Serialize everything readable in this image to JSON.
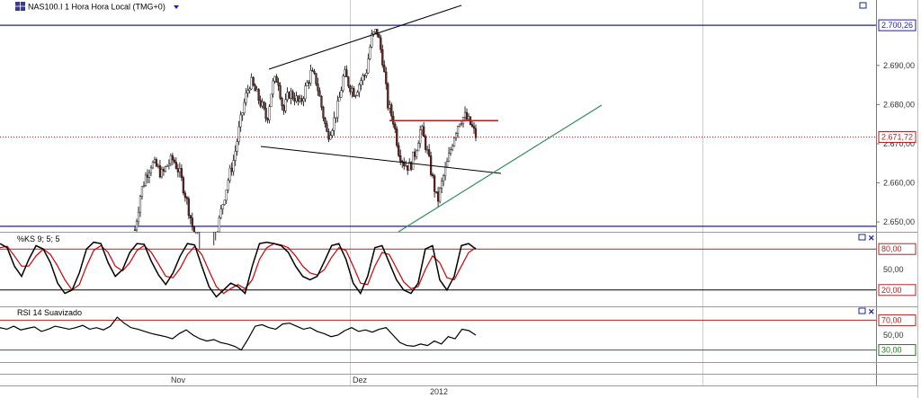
{
  "header": {
    "symbol_title": "NAS100.I 1 Hora Hora Local (TMG+0)",
    "symbol_icon": "symbol-grid-icon",
    "dropdown_icon": "caret-down-icon"
  },
  "colors": {
    "bull": "#ffffff",
    "bear": "#8b1a1a",
    "wick": "#000000",
    "hline_blue": "#1f1f9e",
    "last_price": "#b22222",
    "resistance": "#b22222",
    "uptrend": "#2e8b57",
    "stoch_k": "#000000",
    "stoch_d": "#cc0000",
    "rsi_line": "#000000",
    "rsi_upper": "#b22222",
    "rsi_lower": "#1a7a1a"
  },
  "price_panel": {
    "y_ticks": [
      "2.690,00",
      "2.680,00",
      "2.670,00",
      "2.660,00",
      "2.650,00"
    ],
    "y_tick_values": [
      2690,
      2680,
      2670,
      2660,
      2650
    ],
    "top_line_label": "2.700,26",
    "top_line_value": 2700.26,
    "last_price_label": "2.671,72",
    "last_price_value": 2671.72,
    "lower_line_value": 2648.9,
    "resistance_value": 2675.9,
    "y_range": [
      2647.5,
      2703.5
    ]
  },
  "stoch_panel": {
    "title": "%KS 9; 5; 5",
    "levels": [
      "80,00",
      "50,00",
      "20,00"
    ],
    "level_values": [
      80,
      50,
      20
    ],
    "upper_level": 80,
    "lower_level": 20,
    "y_range": [
      0,
      100
    ]
  },
  "rsi_panel": {
    "title": "RSI 14 Suavizado",
    "levels": [
      "70,00",
      "50,00",
      "30,00"
    ],
    "level_values": [
      70,
      50,
      30
    ],
    "upper_level": 70,
    "lower_level": 30,
    "y_range": [
      15,
      85
    ]
  },
  "x_axis": {
    "months": [
      "Nov",
      "Dez"
    ],
    "year": "2012"
  },
  "chart_data": {
    "type": "candlestick",
    "title": "NAS100.I 1 Hora Hora Local (TMG+0)",
    "xlabel": "",
    "ylabel": "",
    "x_labels": [
      "Nov",
      "Dez",
      "2012"
    ],
    "ylim": [
      2647.5,
      2703.5
    ],
    "series": [
      {
        "name": "NAS100.I",
        "close_path": [
          2648,
          2657,
          2662,
          2665,
          2664,
          2662,
          2665,
          2666,
          2663,
          2658,
          2652,
          2645,
          2640,
          2638,
          2641,
          2648,
          2655,
          2661,
          2666,
          2674,
          2681,
          2686,
          2683,
          2680,
          2676,
          2685,
          2687,
          2678,
          2683,
          2682,
          2680,
          2684,
          2688,
          2686,
          2679,
          2672,
          2675,
          2680,
          2688,
          2685,
          2683,
          2686,
          2688,
          2697,
          2699,
          2692,
          2680,
          2676,
          2668,
          2665,
          2664,
          2668,
          2674,
          2669,
          2662,
          2655,
          2661,
          2666,
          2672,
          2676,
          2677,
          2675,
          2672
        ]
      }
    ],
    "indicators": [
      {
        "name": "%KS 9; 5; 5",
        "k_path": [
          88,
          82,
          55,
          40,
          65,
          85,
          80,
          60,
          30,
          15,
          20,
          45,
          80,
          90,
          88,
          60,
          40,
          50,
          75,
          88,
          87,
          62,
          42,
          28,
          45,
          70,
          88,
          86,
          55,
          25,
          10,
          20,
          30,
          25,
          15,
          55,
          88,
          90,
          88,
          85,
          75,
          55,
          40,
          35,
          40,
          62,
          85,
          88,
          65,
          30,
          15,
          40,
          82,
          85,
          60,
          35,
          20,
          15,
          30,
          80,
          85,
          35,
          20,
          40,
          85,
          88,
          80
        ],
        "d_path": [
          82,
          84,
          70,
          55,
          55,
          70,
          80,
          72,
          55,
          35,
          20,
          28,
          55,
          78,
          85,
          75,
          55,
          48,
          60,
          78,
          85,
          75,
          58,
          40,
          38,
          52,
          72,
          84,
          72,
          48,
          25,
          15,
          22,
          28,
          22,
          35,
          65,
          82,
          88,
          86,
          82,
          70,
          55,
          45,
          42,
          50,
          68,
          82,
          78,
          55,
          30,
          28,
          55,
          75,
          72,
          52,
          32,
          22,
          25,
          50,
          70,
          60,
          38,
          35,
          55,
          75,
          82
        ]
      },
      {
        "name": "RSI 14 Suavizado",
        "rsi_path": [
          60,
          58,
          62,
          57,
          59,
          61,
          55,
          58,
          62,
          60,
          58,
          60,
          63,
          58,
          60,
          57,
          62,
          74,
          66,
          60,
          58,
          55,
          52,
          50,
          48,
          45,
          52,
          57,
          50,
          45,
          42,
          44,
          40,
          38,
          35,
          30,
          45,
          62,
          64,
          60,
          58,
          65,
          66,
          62,
          58,
          60,
          55,
          52,
          48,
          50,
          56,
          60,
          55,
          57,
          54,
          58,
          60,
          50,
          40,
          36,
          35,
          38,
          36,
          42,
          38,
          48,
          45,
          58,
          56,
          50
        ]
      }
    ],
    "annotations": [
      "upper trend line",
      "lower trend line",
      "horizontal resistance",
      "rising support line"
    ]
  }
}
